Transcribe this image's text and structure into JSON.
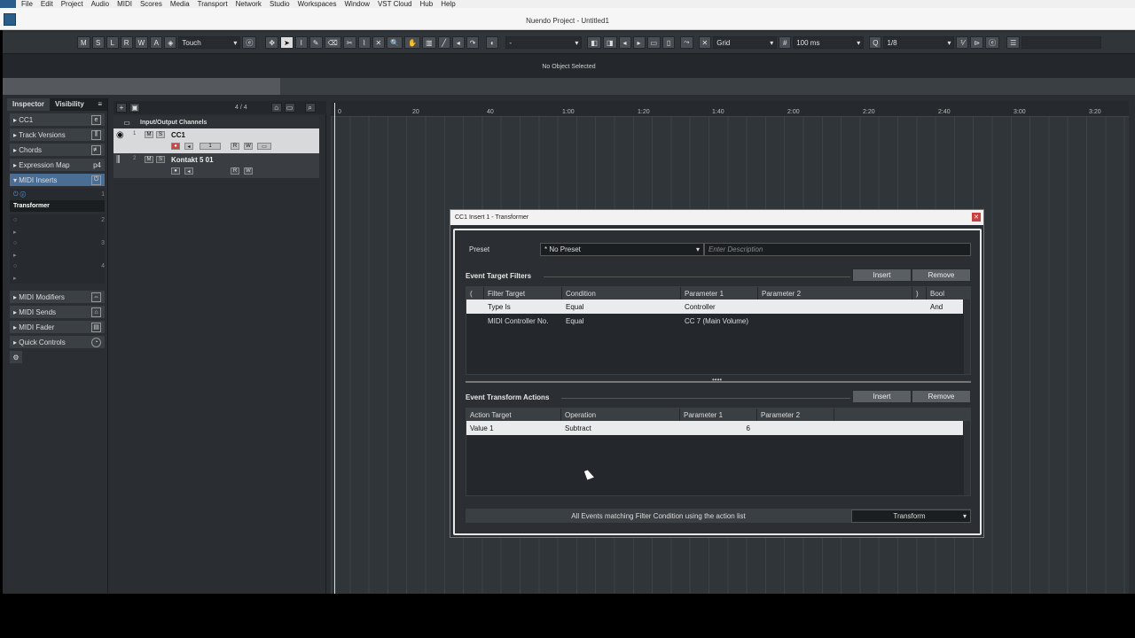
{
  "menubar": {
    "items": [
      "File",
      "Edit",
      "Project",
      "Audio",
      "MIDI",
      "Scores",
      "Media",
      "Transport",
      "Network",
      "Studio",
      "Workspaces",
      "Window",
      "VST Cloud",
      "Hub",
      "Help"
    ]
  },
  "window": {
    "title": "Nuendo Project - Untitled1"
  },
  "toolbar": {
    "mode_buttons": [
      "M",
      "S",
      "L",
      "R",
      "W",
      "A"
    ],
    "automation_mode": "Touch",
    "grid_label": "Grid",
    "grid_value": "100 ms",
    "quantize": "1/8",
    "snap_dash": "-"
  },
  "infoline": {
    "text": "No Object Selected"
  },
  "inspector": {
    "tabs": [
      "Inspector",
      "Visibility"
    ],
    "track_name": "CC1",
    "sections": [
      "Track Versions",
      "Chords",
      "Expression Map",
      "MIDI Inserts",
      "MIDI Modifiers",
      "MIDI Sends",
      "MIDI Fader",
      "Quick Controls"
    ],
    "insert_slot_1": "Transformer",
    "slot_numbers": [
      "1",
      "2",
      "3",
      "4"
    ],
    "expression_map_value": "p4"
  },
  "tracklist": {
    "counter": "4 / 4",
    "folder_name": "Input/Output Channels",
    "tracks": [
      {
        "num": "1",
        "name": "CC1",
        "buttons": [
          "M",
          "S"
        ],
        "channel": "1",
        "rw": [
          "R",
          "W"
        ]
      },
      {
        "num": "2",
        "name": "Kontakt 5 01",
        "buttons": [
          "M",
          "S"
        ],
        "rw": [
          "R",
          "W"
        ]
      }
    ]
  },
  "ruler": {
    "ticks": [
      "0",
      "20",
      "40",
      "1:00",
      "1:20",
      "1:40",
      "2:00",
      "2:20",
      "2:40",
      "3:00",
      "3:20"
    ]
  },
  "dialog": {
    "title": "CC1 Insert 1 - Transformer",
    "close": "x",
    "preset_label": "Preset",
    "preset_value": "* No Preset",
    "description_placeholder": "Enter Description",
    "filters": {
      "title": "Event Target Filters",
      "insert": "Insert",
      "remove": "Remove",
      "columns": [
        "(",
        "Filter Target",
        "Condition",
        "Parameter 1",
        "Parameter 2",
        ")",
        "Bool"
      ],
      "rows": [
        {
          "target": "Type Is",
          "condition": "Equal",
          "param1": "Controller",
          "param2": "",
          "bool": "And"
        },
        {
          "target": "MIDI Controller No.",
          "condition": "Equal",
          "param1": "CC 7  (Main Volume)",
          "param2": "",
          "bool": ""
        }
      ]
    },
    "actions": {
      "title": "Event Transform Actions",
      "insert": "Insert",
      "remove": "Remove",
      "columns": [
        "Action Target",
        "Operation",
        "Parameter 1",
        "Parameter 2"
      ],
      "rows": [
        {
          "target": "Value 1",
          "operation": "Subtract",
          "param1": "6",
          "param2": ""
        }
      ]
    },
    "function_text": "All Events matching Filter Condition using the action list",
    "function_value": "Transform"
  }
}
